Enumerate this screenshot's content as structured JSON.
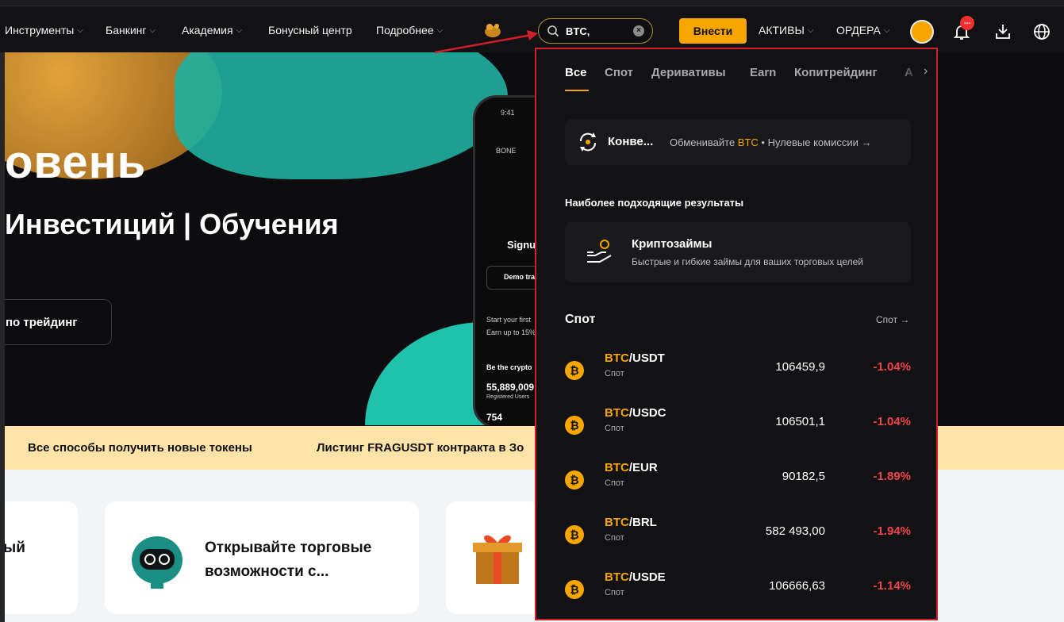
{
  "nav": {
    "items": [
      {
        "label": "Инструменты"
      },
      {
        "label": "Банкинг"
      },
      {
        "label": "Академия"
      },
      {
        "label": "Бонусный центр"
      },
      {
        "label": "Подробнее"
      }
    ],
    "search_value": "BTC,",
    "deposit_label": "Внести",
    "assets_label": "АКТИВЫ",
    "orders_label": "ОРДЕРА",
    "notif_badge": "..."
  },
  "hero": {
    "title": "овень",
    "subtitle": "Инвестиций  |  Обучения",
    "button_label": "по трейдинг",
    "phone": {
      "time": "9:41",
      "search": "BONE",
      "signup": "Signup",
      "demo": "Demo tra",
      "start": "Start your first",
      "earn": "Earn up to 15%",
      "be": "Be the crypto",
      "users": "55,889,009",
      "users_label": "Registered Users",
      "num": "754"
    }
  },
  "ticker": {
    "items": [
      "Все способы получить новые токены",
      "Листинг FRAGUSDT контракта в Зо"
    ]
  },
  "cards": {
    "left_text": "ый",
    "middle_text_line1": "Открывайте торговые",
    "middle_text_line2": "возможности с..."
  },
  "dropdown": {
    "tabs": [
      {
        "label": "Все",
        "active": true
      },
      {
        "label": "Спот",
        "active": false
      },
      {
        "label": "Деривативы",
        "active": false
      },
      {
        "label": "Earn",
        "active": false
      },
      {
        "label": "Копитрейдинг",
        "active": false
      },
      {
        "label": "А",
        "active": false
      }
    ],
    "convert": {
      "title": "Конве...",
      "desc_prefix": "Обменивайте ",
      "desc_highlight": "BTC",
      "desc_suffix": " • Нулевые комиссии →"
    },
    "best_results_label": "Наиболее подходящие результаты",
    "result": {
      "title": "Криптозаймы",
      "desc": "Быстрые и гибкие займы для ваших торговых целей"
    },
    "spot_header": "Спот",
    "spot_link": "Спот →",
    "pairs": [
      {
        "base": "BTC",
        "quote": "/USDT",
        "type": "Спот",
        "price": "106459,9",
        "change": "-1.04%"
      },
      {
        "base": "BTC",
        "quote": "/USDC",
        "type": "Спот",
        "price": "106501,1",
        "change": "-1.04%"
      },
      {
        "base": "BTC",
        "quote": "/EUR",
        "type": "Спот",
        "price": "90182,5",
        "change": "-1.89%"
      },
      {
        "base": "BTC",
        "quote": "/BRL",
        "type": "Спот",
        "price": "582 493,00",
        "change": "-1.94%"
      },
      {
        "base": "BTC",
        "quote": "/USDE",
        "type": "Спот",
        "price": "106666,63",
        "change": "-1.14%"
      }
    ]
  },
  "colors": {
    "accent": "#f7a600",
    "negative": "#f0454b",
    "highlight_border": "#d11f2a"
  }
}
